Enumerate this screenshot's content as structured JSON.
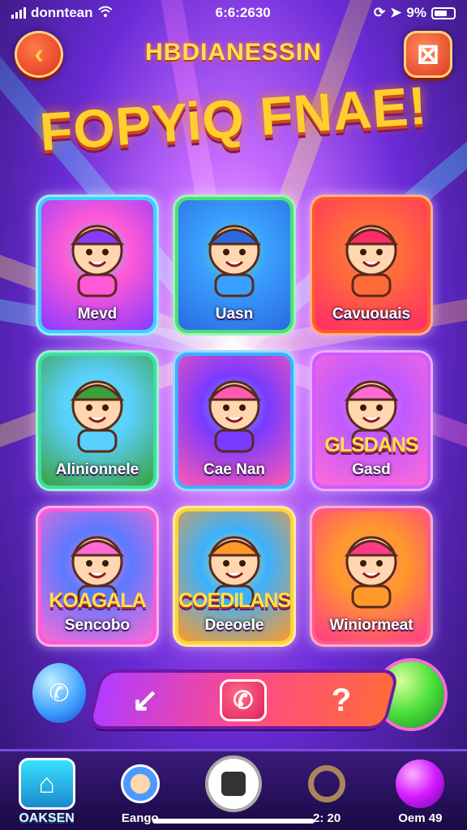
{
  "status_bar": {
    "carrier": "donntean",
    "time": "6:6:2630",
    "battery_text": "9%"
  },
  "header": {
    "subtitle": "HBDIANESSIN",
    "title": "FOPYiQ FNAE!",
    "back_icon": "chevron-left-icon",
    "menu_icon": "exit-icon"
  },
  "cards": [
    {
      "label": "Mevd",
      "badge": "",
      "colors": [
        "#ff5ad6",
        "#8a3aff"
      ],
      "border": "#3ad0ff",
      "art": "character-boy-green-hat"
    },
    {
      "label": "Uasn",
      "badge": "",
      "colors": [
        "#3aa0ff",
        "#2a6ae0"
      ],
      "border": "#4ae07a",
      "art": "green-ball"
    },
    {
      "label": "Cavuouais",
      "badge": "",
      "colors": [
        "#ff6a3a",
        "#ff2a6a"
      ],
      "border": "#ff5a2a",
      "art": "blue-robot-cat"
    },
    {
      "label": "Alinionnele",
      "badge": "",
      "colors": [
        "#5ad0ff",
        "#3aa03a"
      ],
      "border": "#3ae0a0",
      "art": "boy-balloon"
    },
    {
      "label": "Cae Nan",
      "badge": "",
      "colors": [
        "#7a3aff",
        "#ff5ab0"
      ],
      "border": "#3ab0ff",
      "art": "cowboy-character"
    },
    {
      "label": "Gasd",
      "badge": "GLSDANS",
      "colors": [
        "#c05aff",
        "#ff6ad6"
      ],
      "border": "#d05aff",
      "art": "pink-cat-girl"
    },
    {
      "label": "Sencobo",
      "badge": "KOAGALA",
      "colors": [
        "#5a7aff",
        "#ff6ad6"
      ],
      "border": "#ff5ad6",
      "art": "orange-hair-boy"
    },
    {
      "label": "Deeoele",
      "badge": "COEDILANS",
      "colors": [
        "#3ab0ff",
        "#ff9a2a"
      ],
      "border": "#ffd23a",
      "art": "green-hair-character"
    },
    {
      "label": "Winiormeat",
      "badge": "",
      "colors": [
        "#ff9a2a",
        "#ff3a8a"
      ],
      "border": "#ff5a8a",
      "art": "pink-bear"
    }
  ],
  "action_bar": {
    "left_icon": "arrow-icon",
    "mid_icon": "phone-icon",
    "right_icon": "question-icon",
    "right_text": "?"
  },
  "bottom_nav": [
    {
      "label": "OAKSEN",
      "icon": "home-icon"
    },
    {
      "label": "Eango",
      "icon": "avatar-icon"
    },
    {
      "label": "",
      "icon": "record-icon"
    },
    {
      "label": "2: 20",
      "icon": "chat-icon"
    },
    {
      "label": "Oem 49",
      "icon": "orb-icon"
    }
  ]
}
